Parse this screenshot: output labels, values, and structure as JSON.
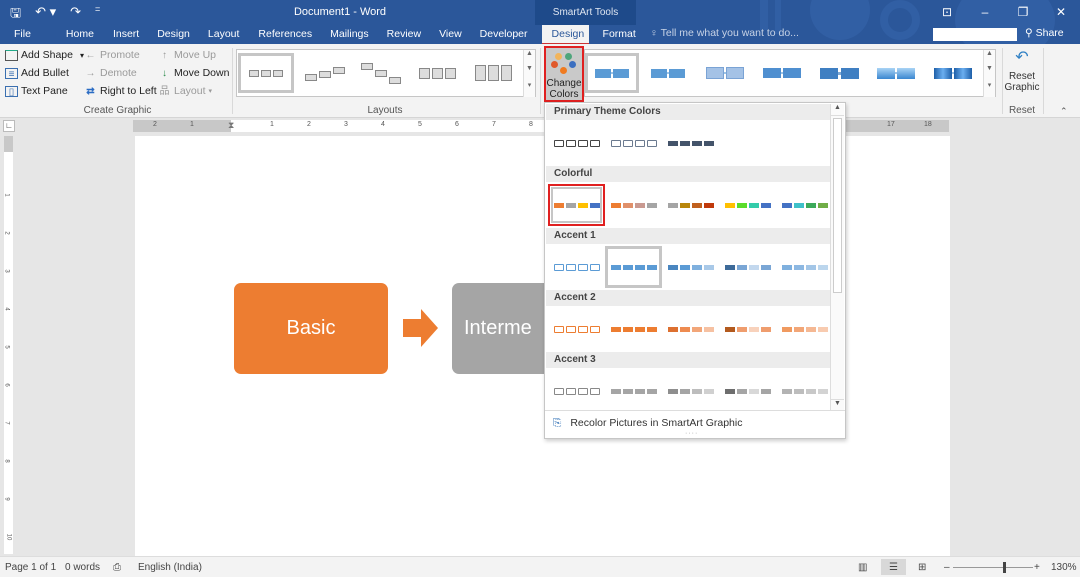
{
  "title_bar": {
    "document_title": "Document1 - Word",
    "context_group": "SmartArt Tools",
    "quick_access": [
      {
        "icon": "save-icon",
        "glyph": "🖫"
      },
      {
        "icon": "undo-icon",
        "glyph": "↶ ▾"
      },
      {
        "icon": "redo-icon",
        "glyph": "↷"
      },
      {
        "icon": "customize-qat-icon",
        "glyph": "="
      }
    ],
    "window_controls": [
      {
        "icon": "ribbon-display-options-icon",
        "glyph": "⊡"
      },
      {
        "icon": "minimize-icon",
        "glyph": "–"
      },
      {
        "icon": "restore-icon",
        "glyph": "❐"
      },
      {
        "icon": "close-icon",
        "glyph": "✕"
      }
    ]
  },
  "tabs": [
    "File",
    "Home",
    "Insert",
    "Design",
    "Layout",
    "References",
    "Mailings",
    "Review",
    "View",
    "Developer",
    "Design",
    "Format"
  ],
  "active_tab": "Design",
  "tell_me": {
    "icon": "lightbulb-icon",
    "placeholder": "Tell me what you want to do..."
  },
  "share": {
    "label": "Share",
    "icon": "person-add-icon"
  },
  "ribbon": {
    "create_graphic": {
      "label": "Create Graphic",
      "add_shape": "Add Shape",
      "add_bullet": "Add Bullet",
      "text_pane": "Text Pane",
      "promote": "Promote",
      "demote": "Demote",
      "right_to_left": "Right to Left",
      "move_up": "Move Up",
      "move_down": "Move Down",
      "layout": "Layout"
    },
    "layouts": {
      "label": "Layouts",
      "count": 5
    },
    "change_colors": {
      "line1": "Change",
      "line2": "Colors ▾"
    },
    "smartart_styles": {
      "count": 7
    },
    "reset": {
      "label": "Reset",
      "button_line1": "Reset",
      "button_line2": "Graphic"
    }
  },
  "ruler": {
    "left_ticks": [
      "2",
      "1"
    ],
    "right_ticks": [
      "1",
      "2",
      "3",
      "4",
      "5",
      "6",
      "7",
      "8"
    ],
    "far_ticks": [
      "17",
      "18"
    ],
    "vertical_ticks": [
      "1",
      "2",
      "3",
      "4",
      "5",
      "6",
      "7",
      "8",
      "9",
      "10"
    ]
  },
  "smartart": {
    "shapes": [
      {
        "text": "Basic",
        "color": "#ed7d31"
      },
      {
        "text": "Interme",
        "color": "#a5a5a5"
      }
    ],
    "arrow_color": "#ed7d31"
  },
  "color_dropdown": {
    "sections": [
      {
        "title": "Primary Theme Colors",
        "swatches": [
          {
            "colors": [
              "#444444",
              "#444444",
              "#444444",
              "#444444"
            ],
            "outline": true
          },
          {
            "colors": [
              "#6b7a8f",
              "#6b7a8f",
              "#6b7a8f",
              "#6b7a8f"
            ],
            "outline": true
          },
          {
            "colors": [
              "#44546a",
              "#44546a",
              "#44546a",
              "#44546a"
            ],
            "outline": false
          }
        ]
      },
      {
        "title": "Colorful",
        "swatches": [
          {
            "colors": [
              "#ed7d31",
              "#a5a5a5",
              "#ffc000",
              "#4472c4"
            ],
            "outline": false,
            "selected": "red"
          },
          {
            "colors": [
              "#ed7d31",
              "#e0906a",
              "#c99a91",
              "#a5a5a5"
            ],
            "outline": false
          },
          {
            "colors": [
              "#a5a5a5",
              "#b8860b",
              "#c0601e",
              "#c0390b"
            ],
            "outline": false
          },
          {
            "colors": [
              "#ffc000",
              "#5adc2b",
              "#33ccaa",
              "#4472c4"
            ],
            "outline": false
          },
          {
            "colors": [
              "#4472c4",
              "#3fc1c9",
              "#3caa5a",
              "#70ad47"
            ],
            "outline": false
          }
        ]
      },
      {
        "title": "Accent 1",
        "swatches": [
          {
            "colors": [
              "#5b9bd5",
              "#5b9bd5",
              "#5b9bd5",
              "#5b9bd5"
            ],
            "outline": true
          },
          {
            "colors": [
              "#5b9bd5",
              "#5b9bd5",
              "#5b9bd5",
              "#5b9bd5"
            ],
            "outline": false,
            "selected": "grey"
          },
          {
            "colors": [
              "#4a86c0",
              "#5b9bd5",
              "#7fb0de",
              "#a9c9e8"
            ],
            "outline": false
          },
          {
            "colors": [
              "#3d6a99",
              "#7aa6d5",
              "#c3d8ee",
              "#7aa6d5"
            ],
            "outline": false
          },
          {
            "colors": [
              "#7fb0de",
              "#8db8e2",
              "#a3c6e7",
              "#bcd6ed"
            ],
            "outline": false
          }
        ]
      },
      {
        "title": "Accent 2",
        "swatches": [
          {
            "colors": [
              "#ed7d31",
              "#ed7d31",
              "#ed7d31",
              "#ed7d31"
            ],
            "outline": true
          },
          {
            "colors": [
              "#ed7d31",
              "#ed7d31",
              "#ed7d31",
              "#ed7d31"
            ],
            "outline": false
          },
          {
            "colors": [
              "#dd7030",
              "#ee8b50",
              "#f2a679",
              "#f6c1a2"
            ],
            "outline": false
          },
          {
            "colors": [
              "#b35a1e",
              "#ef9d6e",
              "#f8d2bc",
              "#ef9d6e"
            ],
            "outline": false
          },
          {
            "colors": [
              "#f09a60",
              "#f2a677",
              "#f5b893",
              "#f8cbb0"
            ],
            "outline": false
          }
        ]
      },
      {
        "title": "Accent 3",
        "swatches": [
          {
            "colors": [
              "#888888",
              "#888888",
              "#888888",
              "#888888"
            ],
            "outline": true
          },
          {
            "colors": [
              "#a5a5a5",
              "#a5a5a5",
              "#a5a5a5",
              "#a5a5a5"
            ],
            "outline": false
          },
          {
            "colors": [
              "#8e8e8e",
              "#a5a5a5",
              "#bdbdbd",
              "#d0d0d0"
            ],
            "outline": false
          },
          {
            "colors": [
              "#6e6e6e",
              "#a5a5a5",
              "#d8d8d8",
              "#a5a5a5"
            ],
            "outline": false
          },
          {
            "colors": [
              "#b3b3b3",
              "#bdbdbd",
              "#c8c8c8",
              "#d3d3d3"
            ],
            "outline": false
          }
        ]
      }
    ],
    "footer": "Recolor Pictures in SmartArt Graphic",
    "footer_icon": "recolor-pictures-icon"
  },
  "status_bar": {
    "page": "Page 1 of 1",
    "words": "0 words",
    "proofing_icon": "proofing-icon",
    "language": "English (India)",
    "views": [
      "read-mode-icon",
      "print-layout-icon",
      "web-layout-icon"
    ],
    "zoom_minus": "–",
    "zoom_plus": "+",
    "zoom_level": "130%",
    "zoom_fraction": 0.62
  }
}
